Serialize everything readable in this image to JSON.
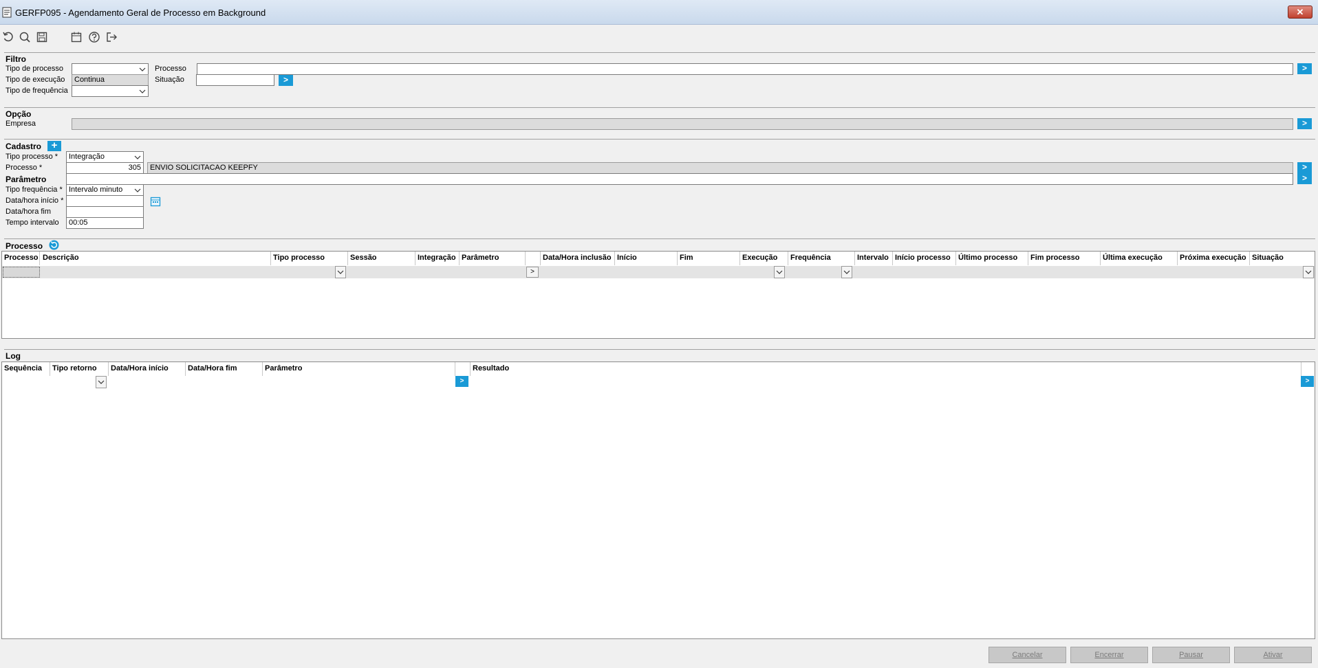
{
  "window": {
    "title": "GERFP095 - Agendamento Geral de Processo em Background",
    "close_label": "✕"
  },
  "toolbar": {
    "icons": [
      "refresh-icon",
      "search-icon",
      "save-icon",
      "calendar-icon",
      "help-icon",
      "exit-icon"
    ]
  },
  "filtro": {
    "title": "Filtro",
    "tipo_processo_label": "Tipo de processo",
    "tipo_processo_value": "",
    "tipo_execucao_label": "Tipo de execução",
    "tipo_execucao_value": "Continua",
    "tipo_frequencia_label": "Tipo de frequência",
    "tipo_frequencia_value": "",
    "processo_label": "Processo",
    "processo_value": "",
    "situacao_label": "Situação",
    "situacao_value": "",
    "go_label": ">"
  },
  "opcao": {
    "title": "Opção",
    "empresa_label": "Empresa",
    "empresa_value": "",
    "go_label": ">"
  },
  "cadastro": {
    "title": "Cadastro",
    "add_label": "+",
    "tipo_processo_label": "Tipo processo *",
    "tipo_processo_value": "Integração",
    "processo_label": "Processo *",
    "processo_code": "305",
    "processo_desc": "ENVIO SOLICITACAO KEEPFY",
    "parametro_label": "Parâmetro",
    "parametro_value": "",
    "tipo_frequencia_label": "Tipo frequência *",
    "tipo_frequencia_value": "Intervalo minuto",
    "data_inicio_label": "Data/hora início *",
    "data_inicio_value": "",
    "data_fim_label": "Data/hora fim",
    "data_fim_value": "",
    "tempo_intervalo_label": "Tempo intervalo",
    "tempo_intervalo_value": "00:05",
    "go_label": ">"
  },
  "processo_grid": {
    "title": "Processo",
    "columns": [
      "Processo",
      "Descrição",
      "Tipo processo",
      "Sessão",
      "Integração",
      "Parâmetro",
      "",
      "Data/Hora inclusão",
      "Início",
      "Fim",
      "Execução",
      "Frequência",
      "Intervalo",
      "Início processo",
      "Último processo",
      "Fim processo",
      "Última execução",
      "Próxima execução",
      "Situação"
    ],
    "param_btn": ">"
  },
  "log_grid": {
    "title": "Log",
    "columns": [
      "Sequência",
      "Tipo retorno",
      "Data/Hora início",
      "Data/Hora fim",
      "Parâmetro",
      "",
      "Resultado"
    ],
    "go_label": ">"
  },
  "footer": {
    "cancelar": "Cancelar",
    "encerrar": "Encerrar",
    "pausar": "Pausar",
    "ativar": "Ativar"
  },
  "colors": {
    "accent": "#1a9ad6",
    "titlebar": "#c9d9ec"
  }
}
